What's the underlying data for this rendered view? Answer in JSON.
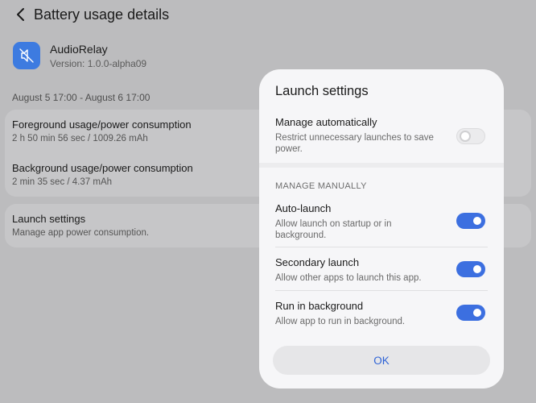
{
  "header": {
    "title": "Battery usage details",
    "back_icon": "back-arrow-icon"
  },
  "app": {
    "name": "AudioRelay",
    "version": "Version: 1.0.0-alpha09",
    "icon": "audiorelay-app-icon",
    "icon_color": "#3d7be0"
  },
  "date_range": "August 5 17:00 - August 6 17:00",
  "usage": {
    "foreground": {
      "title": "Foreground usage/power consumption",
      "value": "2 h 50 min 56 sec / 1009.26 mAh"
    },
    "background": {
      "title": "Background usage/power consumption",
      "value": "2 min 35 sec / 4.37 mAh"
    }
  },
  "launch_settings_row": {
    "title": "Launch settings",
    "subtitle": "Manage app power consumption."
  },
  "dialog": {
    "title": "Launch settings",
    "manage_automatically": {
      "title": "Manage automatically",
      "subtitle": "Restrict unnecessary launches to save power.",
      "enabled": false
    },
    "section_label": "MANAGE MANUALLY",
    "auto_launch": {
      "title": "Auto-launch",
      "subtitle": "Allow launch on startup or in background.",
      "enabled": true
    },
    "secondary_launch": {
      "title": "Secondary launch",
      "subtitle": "Allow other apps to launch this app.",
      "enabled": true
    },
    "run_in_background": {
      "title": "Run in background",
      "subtitle": "Allow app to run in background.",
      "enabled": true
    },
    "ok_label": "OK"
  },
  "colors": {
    "accent": "#3c6fe0",
    "ok_text": "#2e63d6"
  }
}
